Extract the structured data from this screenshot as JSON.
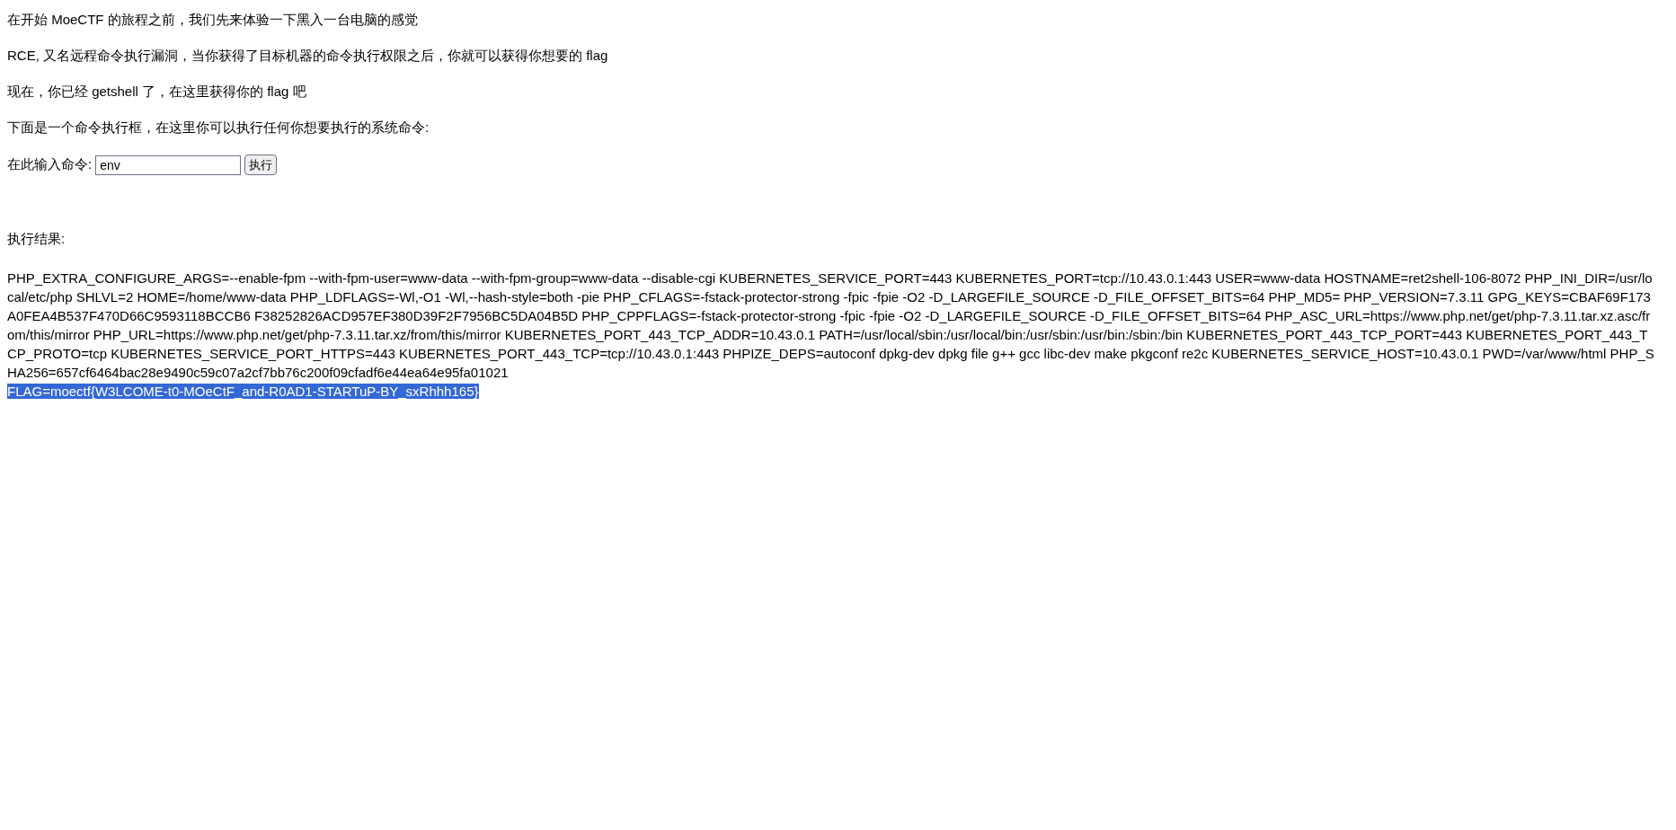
{
  "intro": [
    "在开始 MoeCTF 的旅程之前，我们先来体验一下黑入一台电脑的感觉",
    "RCE, 又名远程命令执行漏洞，当你获得了目标机器的命令执行权限之后，你就可以获得你想要的 flag",
    "现在，你已经 getshell 了，在这里获得你的 flag 吧",
    "下面是一个命令执行框，在这里你可以执行任何你想要执行的系统命令:"
  ],
  "command_form": {
    "label": "在此输入命令:",
    "value": "env",
    "button": "执行"
  },
  "result": {
    "heading": "执行结果:",
    "output": "PHP_EXTRA_CONFIGURE_ARGS=--enable-fpm --with-fpm-user=www-data --with-fpm-group=www-data --disable-cgi KUBERNETES_SERVICE_PORT=443 KUBERNETES_PORT=tcp://10.43.0.1:443 USER=www-data HOSTNAME=ret2shell-106-8072 PHP_INI_DIR=/usr/local/etc/php SHLVL=2 HOME=/home/www-data PHP_LDFLAGS=-Wl,-O1 -Wl,--hash-style=both -pie PHP_CFLAGS=-fstack-protector-strong -fpic -fpie -O2 -D_LARGEFILE_SOURCE -D_FILE_OFFSET_BITS=64 PHP_MD5= PHP_VERSION=7.3.11 GPG_KEYS=CBAF69F173A0FEA4B537F470D66C9593118BCCB6 F38252826ACD957EF380D39F2F7956BC5DA04B5D PHP_CPPFLAGS=-fstack-protector-strong -fpic -fpie -O2 -D_LARGEFILE_SOURCE -D_FILE_OFFSET_BITS=64 PHP_ASC_URL=https://www.php.net/get/php-7.3.11.tar.xz.asc/from/this/mirror PHP_URL=https://www.php.net/get/php-7.3.11.tar.xz/from/this/mirror KUBERNETES_PORT_443_TCP_ADDR=10.43.0.1 PATH=/usr/local/sbin:/usr/local/bin:/usr/sbin:/usr/bin:/sbin:/bin KUBERNETES_PORT_443_TCP_PORT=443 KUBERNETES_PORT_443_TCP_PROTO=tcp KUBERNETES_SERVICE_PORT_HTTPS=443 KUBERNETES_PORT_443_TCP=tcp://10.43.0.1:443 PHPIZE_DEPS=autoconf dpkg-dev dpkg file g++ gcc libc-dev make pkgconf re2c KUBERNETES_SERVICE_HOST=10.43.0.1 PWD=/var/www/html PHP_SHA256=657cf6464bac28e9490c59c07a2cf7bb76c200f09cfadf6e44ea64e95fa01021",
    "flag": {
      "text": "FLAG=moectf{W3LCOME-t0-MOeCtF_and-R0AD1-STARTuP-BY_sxRhhh165}",
      "selected": true
    }
  }
}
